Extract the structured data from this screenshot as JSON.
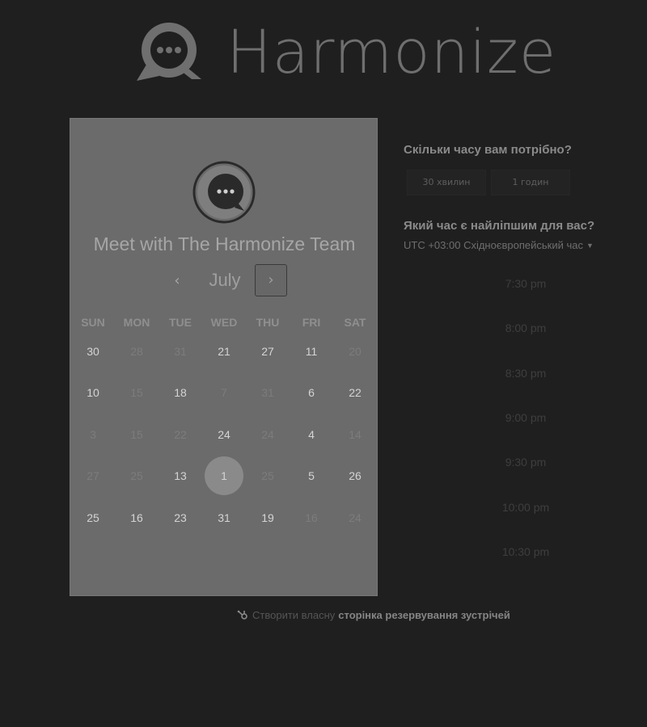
{
  "header": {
    "brand": "Harmonize",
    "logo_icon": "chat-bubble-icon"
  },
  "calendar": {
    "title": "Meet with The Harmonize Team",
    "month": "July",
    "prev_icon": "chevron-left-icon",
    "next_icon": "chevron-right-icon",
    "prev_glyph": "‹",
    "next_glyph": "›",
    "weekdays": [
      "SUN",
      "MON",
      "TUE",
      "WED",
      "THU",
      "FRI",
      "SAT"
    ],
    "weeks": [
      [
        {
          "d": "30",
          "active": true
        },
        {
          "d": "28",
          "active": false
        },
        {
          "d": "31",
          "active": false
        },
        {
          "d": "21",
          "active": true
        },
        {
          "d": "27",
          "active": true
        },
        {
          "d": "11",
          "active": true
        },
        {
          "d": "20",
          "active": false
        }
      ],
      [
        {
          "d": "10",
          "active": true
        },
        {
          "d": "15",
          "active": false
        },
        {
          "d": "18",
          "active": true
        },
        {
          "d": "7",
          "active": false
        },
        {
          "d": "31",
          "active": false
        },
        {
          "d": "6",
          "active": true
        },
        {
          "d": "22",
          "active": true
        }
      ],
      [
        {
          "d": "3",
          "active": false
        },
        {
          "d": "15",
          "active": false
        },
        {
          "d": "22",
          "active": false
        },
        {
          "d": "24",
          "active": true
        },
        {
          "d": "24",
          "active": false
        },
        {
          "d": "4",
          "active": true
        },
        {
          "d": "14",
          "active": false
        }
      ],
      [
        {
          "d": "27",
          "active": false
        },
        {
          "d": "25",
          "active": false
        },
        {
          "d": "13",
          "active": true
        },
        {
          "d": "1",
          "active": true,
          "selected": true
        },
        {
          "d": "25",
          "active": false
        },
        {
          "d": "5",
          "active": true
        },
        {
          "d": "26",
          "active": true
        }
      ],
      [
        {
          "d": "25",
          "active": true
        },
        {
          "d": "16",
          "active": true
        },
        {
          "d": "23",
          "active": true
        },
        {
          "d": "31",
          "active": true
        },
        {
          "d": "19",
          "active": true
        },
        {
          "d": "16",
          "active": false
        },
        {
          "d": "24",
          "active": false
        }
      ]
    ]
  },
  "duration": {
    "question": "Скільки часу вам потрібно?",
    "options": [
      "30 хвилин",
      "1 годин"
    ]
  },
  "time": {
    "question": "Який час є найліпшим для вас?",
    "timezone": "UTC +03:00 Східноєвропейський час",
    "slots": [
      "7:30 pm",
      "8:00 pm",
      "8:30 pm",
      "9:00 pm",
      "9:30 pm",
      "10:00 pm",
      "10:30 pm"
    ]
  },
  "footer": {
    "icon": "hubspot-sprocket-icon",
    "text_plain": "Створити власну",
    "text_link": "сторінка резервування зустрічей"
  }
}
